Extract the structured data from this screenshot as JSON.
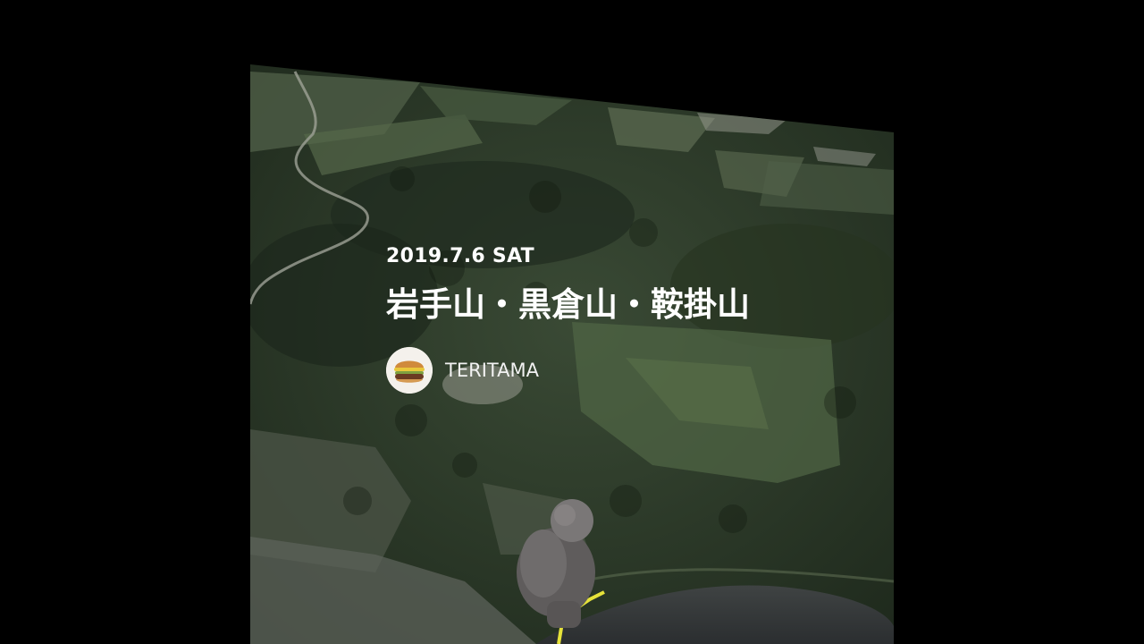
{
  "card": {
    "date": "2019.7.6 SAT",
    "title": "岩手山・黒倉山・鞍掛山",
    "author": {
      "name": "TERITAMA",
      "avatar_icon": "hamburger-icon"
    }
  },
  "map": {
    "view": "3d-terrain-flyover",
    "marker_icon": "hiker-figure-icon",
    "track_color": "#e6e23a"
  },
  "colors": {
    "background": "#000000",
    "text": "#ffffff",
    "avatar_bg": "#f4f1ec"
  }
}
